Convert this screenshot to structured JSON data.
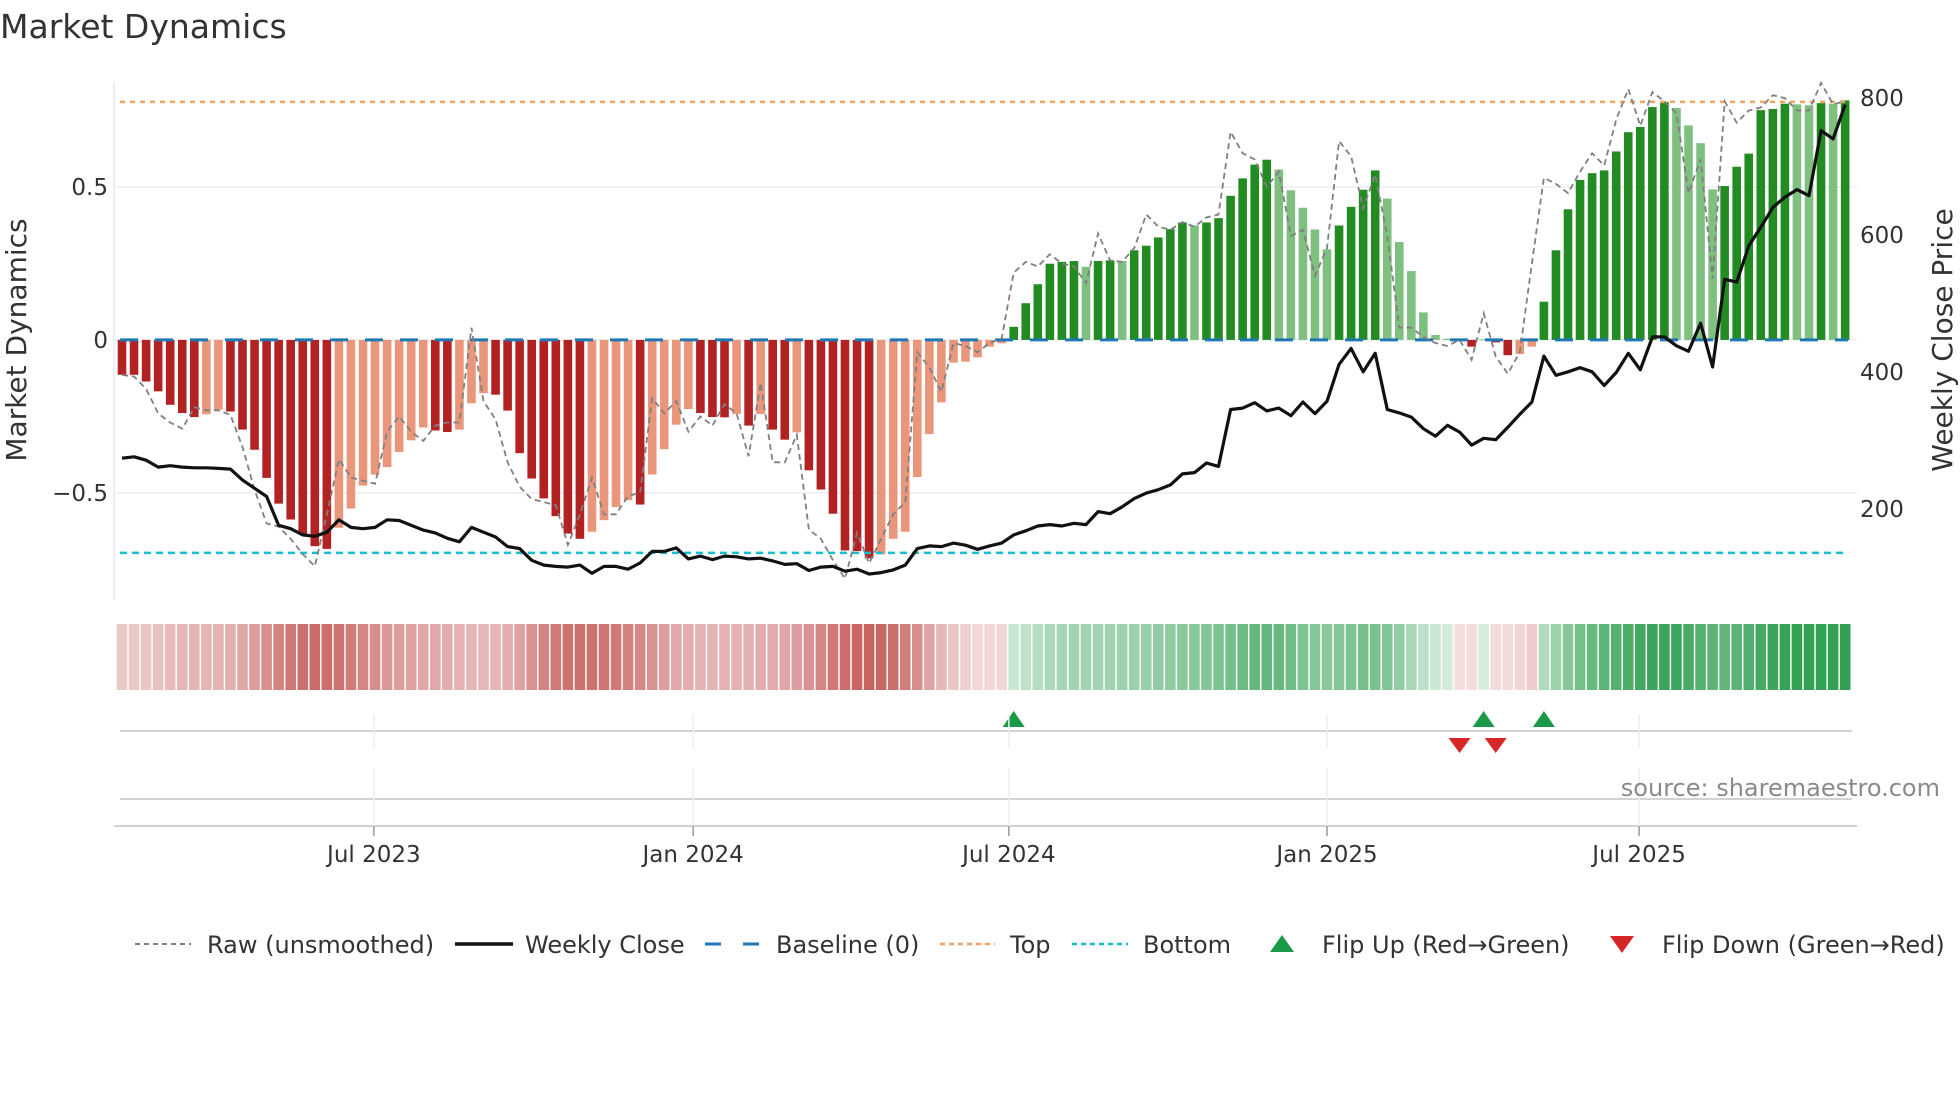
{
  "chart_data": {
    "type": "bar",
    "title": "Market Dynamics",
    "ylabel": "Market Dynamics",
    "y2label": "Weekly Close Price",
    "ylim": [
      -0.85,
      0.843
    ],
    "y2lim": [
      67,
      823
    ],
    "yticks": [
      {
        "v": 0.5,
        "label": "0.5"
      },
      {
        "v": 0,
        "label": "0"
      },
      {
        "v": -0.5,
        "label": "−0.5"
      }
    ],
    "y2ticks": [
      {
        "v": 800,
        "label": "800"
      },
      {
        "v": 600,
        "label": "600"
      },
      {
        "v": 400,
        "label": "400"
      },
      {
        "v": 200,
        "label": "200"
      }
    ],
    "x_unit": "week index",
    "xticks": [
      {
        "week": 20.9,
        "label": "Jul 2023"
      },
      {
        "week": 47.4,
        "label": "Jan 2024"
      },
      {
        "week": 73.6,
        "label": "Jul 2024"
      },
      {
        "week": 100.0,
        "label": "Jan 2025"
      },
      {
        "week": 125.9,
        "label": "Jul 2025"
      }
    ],
    "top_level": 0.778,
    "bottom_level": -0.696,
    "baseline": 0,
    "smoothed": [
      -0.114,
      -0.114,
      -0.136,
      -0.168,
      -0.212,
      -0.239,
      -0.252,
      -0.243,
      -0.228,
      -0.234,
      -0.293,
      -0.359,
      -0.451,
      -0.535,
      -0.587,
      -0.636,
      -0.674,
      -0.683,
      -0.614,
      -0.551,
      -0.476,
      -0.44,
      -0.416,
      -0.366,
      -0.328,
      -0.286,
      -0.296,
      -0.301,
      -0.293,
      -0.207,
      -0.174,
      -0.179,
      -0.231,
      -0.37,
      -0.453,
      -0.518,
      -0.576,
      -0.633,
      -0.65,
      -0.627,
      -0.589,
      -0.546,
      -0.524,
      -0.538,
      -0.44,
      -0.357,
      -0.277,
      -0.226,
      -0.239,
      -0.252,
      -0.253,
      -0.242,
      -0.28,
      -0.242,
      -0.293,
      -0.326,
      -0.302,
      -0.426,
      -0.489,
      -0.568,
      -0.688,
      -0.69,
      -0.714,
      -0.701,
      -0.65,
      -0.627,
      -0.448,
      -0.308,
      -0.204,
      -0.074,
      -0.071,
      -0.057,
      -0.022,
      -0.011,
      0.043,
      0.12,
      0.182,
      0.249,
      0.255,
      0.258,
      0.239,
      0.258,
      0.26,
      0.258,
      0.293,
      0.308,
      0.335,
      0.362,
      0.384,
      0.374,
      0.384,
      0.398,
      0.471,
      0.528,
      0.573,
      0.589,
      0.557,
      0.489,
      0.432,
      0.361,
      0.296,
      0.374,
      0.435,
      0.491,
      0.554,
      0.462,
      0.32,
      0.225,
      0.09,
      0.016,
      0.004,
      -0.003,
      -0.022,
      0.002,
      -0.008,
      -0.05,
      -0.046,
      -0.022,
      0.125,
      0.293,
      0.427,
      0.523,
      0.545,
      0.554,
      0.616,
      0.679,
      0.696,
      0.761,
      0.778,
      0.758,
      0.701,
      0.643,
      0.492,
      0.503,
      0.566,
      0.609,
      0.751,
      0.755,
      0.772,
      0.77,
      0.767,
      0.774,
      0.772,
      0.783
    ],
    "raw": [
      -0.114,
      -0.12,
      -0.16,
      -0.24,
      -0.27,
      -0.29,
      -0.22,
      -0.23,
      -0.23,
      -0.245,
      -0.35,
      -0.49,
      -0.6,
      -0.61,
      -0.65,
      -0.7,
      -0.74,
      -0.57,
      -0.39,
      -0.45,
      -0.46,
      -0.47,
      -0.3,
      -0.25,
      -0.3,
      -0.33,
      -0.28,
      -0.27,
      -0.27,
      0.04,
      -0.2,
      -0.26,
      -0.4,
      -0.48,
      -0.52,
      -0.53,
      -0.54,
      -0.67,
      -0.57,
      -0.45,
      -0.57,
      -0.57,
      -0.51,
      -0.5,
      -0.19,
      -0.24,
      -0.2,
      -0.3,
      -0.25,
      -0.28,
      -0.21,
      -0.24,
      -0.38,
      -0.14,
      -0.4,
      -0.4,
      -0.31,
      -0.62,
      -0.65,
      -0.72,
      -0.78,
      -0.63,
      -0.73,
      -0.65,
      -0.57,
      -0.53,
      -0.04,
      -0.09,
      -0.17,
      -0.01,
      -0.02,
      -0.04,
      -0.01,
      0.005,
      0.22,
      0.255,
      0.24,
      0.28,
      0.25,
      0.24,
      0.185,
      0.348,
      0.26,
      0.255,
      0.3,
      0.41,
      0.37,
      0.36,
      0.385,
      0.37,
      0.4,
      0.41,
      0.68,
      0.61,
      0.59,
      0.5,
      0.55,
      0.34,
      0.36,
      0.21,
      0.3,
      0.65,
      0.6,
      0.43,
      0.54,
      0.34,
      0.04,
      0.04,
      0.01,
      -0.01,
      -0.02,
      0,
      -0.065,
      0.087,
      -0.054,
      -0.11,
      -0.04,
      0.25,
      0.53,
      0.51,
      0.48,
      0.55,
      0.61,
      0.57,
      0.72,
      0.82,
      0.7,
      0.81,
      0.78,
      0.74,
      0.48,
      0.59,
      0.2,
      0.78,
      0.71,
      0.75,
      0.76,
      0.8,
      0.79,
      0.75,
      0.75,
      0.84,
      0.77,
      0.78
    ],
    "weekly_close": [
      274,
      276,
      271,
      261,
      263,
      261,
      260,
      260,
      259,
      258,
      242,
      230,
      218,
      176,
      171,
      162,
      160,
      166,
      184,
      173,
      171,
      173,
      184,
      183,
      176,
      169,
      165,
      157,
      152,
      173,
      166,
      159,
      145,
      142,
      125,
      118,
      116,
      115,
      118,
      106,
      116,
      116,
      112,
      121,
      138,
      138,
      143,
      127,
      131,
      126,
      131,
      130,
      127,
      128,
      124,
      119,
      120,
      110,
      115,
      116,
      109,
      112,
      105,
      107,
      111,
      118,
      142,
      146,
      145,
      150,
      147,
      141,
      146,
      150,
      162,
      168,
      175,
      177,
      175,
      179,
      177,
      196,
      193,
      203,
      215,
      223,
      228,
      235,
      251,
      253,
      267,
      262,
      345,
      347,
      355,
      343,
      347,
      336,
      356,
      339,
      357,
      411,
      434,
      400,
      427,
      345,
      340,
      334,
      317,
      306,
      322,
      312,
      293,
      303,
      301,
      319,
      338,
      356,
      423,
      395,
      400,
      406,
      400,
      380,
      399,
      427,
      403,
      451,
      451,
      438,
      430,
      471,
      407,
      535,
      531,
      584,
      611,
      640,
      655,
      666,
      657,
      752,
      740,
      790
    ],
    "flip_up_weeks": [
      74,
      113,
      118
    ],
    "flip_down_weeks": [
      111,
      114
    ],
    "colors": {
      "bear_strong": "#b22222",
      "bear_weak": "#e9967a",
      "bull_strong": "#228b22",
      "bull_weak": "#7fbf7f",
      "raw": "#808080",
      "close": "#111111",
      "baseline": "#1f77b4",
      "top": "#f4a460",
      "bottom": "#17becf",
      "flip_up": "#1a9a48",
      "flip_down": "#d62728",
      "strip_red": "#c0504d",
      "strip_green": "#2e9e4f"
    },
    "legend": [
      {
        "key": "raw",
        "label": "Raw (unsmoothed)"
      },
      {
        "key": "close",
        "label": "Weekly Close"
      },
      {
        "key": "baseline",
        "label": "Baseline (0)"
      },
      {
        "key": "top",
        "label": "Top"
      },
      {
        "key": "bottom",
        "label": "Bottom"
      },
      {
        "key": "flip_up",
        "label": "Flip Up (Red→Green)"
      },
      {
        "key": "flip_down",
        "label": "Flip Down (Green→Red)"
      }
    ],
    "legend_position": "bottom",
    "source": "source: sharemaestro.com"
  }
}
